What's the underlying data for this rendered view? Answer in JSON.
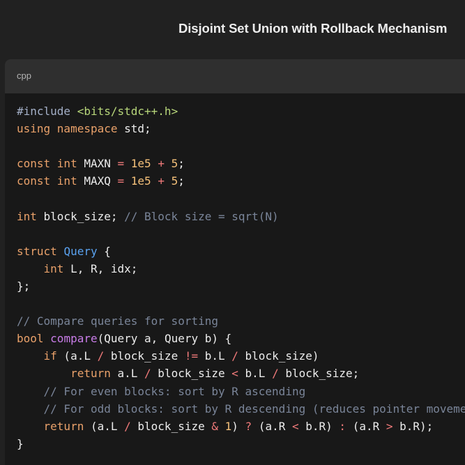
{
  "title": "Disjoint Set Union with Rollback Mechanism",
  "code_block": {
    "language": "cpp",
    "lines": [
      [
        {
          "t": "#include ",
          "c": "pp"
        },
        {
          "t": "<bits/stdc++.h>",
          "c": "str"
        }
      ],
      [
        {
          "t": "using namespace ",
          "c": "kw"
        },
        {
          "t": "std;",
          "c": "pl"
        }
      ],
      [],
      [
        {
          "t": "const int ",
          "c": "kw"
        },
        {
          "t": "MAXN ",
          "c": "pl"
        },
        {
          "t": "=",
          "c": "op"
        },
        {
          "t": " ",
          "c": "pl"
        },
        {
          "t": "1e5",
          "c": "num"
        },
        {
          "t": " ",
          "c": "pl"
        },
        {
          "t": "+",
          "c": "op"
        },
        {
          "t": " ",
          "c": "pl"
        },
        {
          "t": "5",
          "c": "num"
        },
        {
          "t": ";",
          "c": "pl"
        }
      ],
      [
        {
          "t": "const int ",
          "c": "kw"
        },
        {
          "t": "MAXQ ",
          "c": "pl"
        },
        {
          "t": "=",
          "c": "op"
        },
        {
          "t": " ",
          "c": "pl"
        },
        {
          "t": "1e5",
          "c": "num"
        },
        {
          "t": " ",
          "c": "pl"
        },
        {
          "t": "+",
          "c": "op"
        },
        {
          "t": " ",
          "c": "pl"
        },
        {
          "t": "5",
          "c": "num"
        },
        {
          "t": ";",
          "c": "pl"
        }
      ],
      [],
      [
        {
          "t": "int ",
          "c": "kw"
        },
        {
          "t": "block_size; ",
          "c": "pl"
        },
        {
          "t": "// Block size = sqrt(N)",
          "c": "cm"
        }
      ],
      [],
      [
        {
          "t": "struct ",
          "c": "kw"
        },
        {
          "t": "Query",
          "c": "fn"
        },
        {
          "t": " {",
          "c": "pl"
        }
      ],
      [
        {
          "t": "    ",
          "c": "pl"
        },
        {
          "t": "int ",
          "c": "kw"
        },
        {
          "t": "L, R, idx;",
          "c": "pl"
        }
      ],
      [
        {
          "t": "};",
          "c": "pl"
        }
      ],
      [],
      [
        {
          "t": "// Compare queries for sorting",
          "c": "cm"
        }
      ],
      [
        {
          "t": "bool ",
          "c": "kw"
        },
        {
          "t": "compare",
          "c": "fnp"
        },
        {
          "t": "(Query a, Query b) {",
          "c": "pl"
        }
      ],
      [
        {
          "t": "    ",
          "c": "pl"
        },
        {
          "t": "if",
          "c": "kw"
        },
        {
          "t": " (a.L ",
          "c": "pl"
        },
        {
          "t": "/",
          "c": "op"
        },
        {
          "t": " block_size ",
          "c": "pl"
        },
        {
          "t": "!=",
          "c": "op"
        },
        {
          "t": " b.L ",
          "c": "pl"
        },
        {
          "t": "/",
          "c": "op"
        },
        {
          "t": " block_size)",
          "c": "pl"
        }
      ],
      [
        {
          "t": "        ",
          "c": "pl"
        },
        {
          "t": "return",
          "c": "kw"
        },
        {
          "t": " a.L ",
          "c": "pl"
        },
        {
          "t": "/",
          "c": "op"
        },
        {
          "t": " block_size ",
          "c": "pl"
        },
        {
          "t": "<",
          "c": "op"
        },
        {
          "t": " b.L ",
          "c": "pl"
        },
        {
          "t": "/",
          "c": "op"
        },
        {
          "t": " block_size;",
          "c": "pl"
        }
      ],
      [
        {
          "t": "    ",
          "c": "pl"
        },
        {
          "t": "// For even blocks: sort by R ascending",
          "c": "cm"
        }
      ],
      [
        {
          "t": "    ",
          "c": "pl"
        },
        {
          "t": "// For odd blocks: sort by R descending (reduces pointer movement)",
          "c": "cm"
        }
      ],
      [
        {
          "t": "    ",
          "c": "pl"
        },
        {
          "t": "return",
          "c": "kw"
        },
        {
          "t": " (a.L ",
          "c": "pl"
        },
        {
          "t": "/",
          "c": "op"
        },
        {
          "t": " block_size ",
          "c": "pl"
        },
        {
          "t": "&",
          "c": "op"
        },
        {
          "t": " ",
          "c": "pl"
        },
        {
          "t": "1",
          "c": "num"
        },
        {
          "t": ") ",
          "c": "pl"
        },
        {
          "t": "?",
          "c": "op"
        },
        {
          "t": " (a.R ",
          "c": "pl"
        },
        {
          "t": "<",
          "c": "op"
        },
        {
          "t": " b.R) ",
          "c": "pl"
        },
        {
          "t": ":",
          "c": "op"
        },
        {
          "t": " (a.R ",
          "c": "pl"
        },
        {
          "t": ">",
          "c": "op"
        },
        {
          "t": " b.R);",
          "c": "pl"
        }
      ],
      [
        {
          "t": "}",
          "c": "pl"
        }
      ]
    ]
  }
}
